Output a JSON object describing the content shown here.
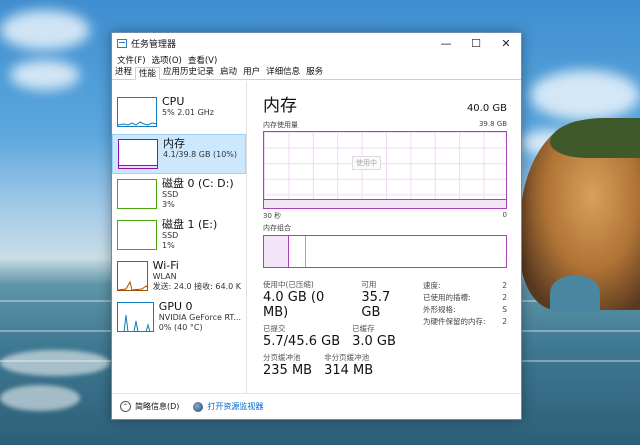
{
  "window": {
    "title": "任务管理器",
    "controls": {
      "minimize": "—",
      "maximize": "☐",
      "close": "✕"
    }
  },
  "menu": [
    "文件(F)",
    "选项(O)",
    "查看(V)"
  ],
  "tabs": [
    "进程",
    "性能",
    "应用历史记录",
    "启动",
    "用户",
    "详细信息",
    "服务"
  ],
  "active_tab": "性能",
  "sidebar": [
    {
      "name": "CPU",
      "lines": [
        "5%  2.01 GHz"
      ],
      "color": "#117dbb"
    },
    {
      "name": "内存",
      "lines": [
        "4.1/39.8 GB (10%)"
      ],
      "color": "#8b12ae"
    },
    {
      "name": "磁盘 0 (C: D:)",
      "lines": [
        "SSD",
        "3%"
      ],
      "color": "#4da60c"
    },
    {
      "name": "磁盘 1 (E:)",
      "lines": [
        "SSD",
        "1%"
      ],
      "color": "#4da60c"
    },
    {
      "name": "Wi-Fi",
      "lines": [
        "WLAN",
        "发送: 24.0 接收: 64.0 K"
      ],
      "color": "#a74f01"
    },
    {
      "name": "GPU 0",
      "lines": [
        "NVIDIA GeForce RT...",
        "0% (40 °C)"
      ],
      "color": "#117dbb"
    }
  ],
  "main": {
    "title": "内存",
    "total": "40.0 GB",
    "usage_label": "内存使用量",
    "usage_max": "39.8 GB",
    "graph_tooltip": "使用中",
    "time_left": "30 秒",
    "time_right": "0",
    "composition_label": "内存组合",
    "composition_used_fraction": 0.105,
    "composition_modified_fraction": 0.17,
    "stats": {
      "in_use_label": "使用中(已压缩)",
      "in_use_value": "4.0 GB (0 MB)",
      "available_label": "可用",
      "available_value": "35.7 GB",
      "committed_label": "已提交",
      "committed_value": "5.7/45.6 GB",
      "cached_label": "已缓存",
      "cached_value": "3.0 GB",
      "paged_label": "分页缓冲池",
      "paged_value": "235 MB",
      "nonpaged_label": "非分页缓冲池",
      "nonpaged_value": "314 MB"
    },
    "details": [
      {
        "label": "速度:",
        "value": "2"
      },
      {
        "label": "已使用的插槽:",
        "value": "2"
      },
      {
        "label": "外形规格:",
        "value": "S"
      },
      {
        "label": "为硬件保留的内存:",
        "value": "2"
      }
    ]
  },
  "footer": {
    "summary": "简略信息(D)",
    "resource_monitor": "打开资源监视器"
  }
}
